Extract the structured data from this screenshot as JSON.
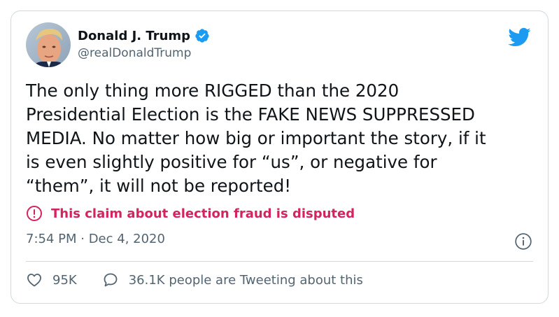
{
  "author": {
    "display_name": "Donald J. Trump",
    "handle": "@realDonaldTrump",
    "verified": true
  },
  "tweet": {
    "text": "The only thing more RIGGED than the 2020\nPresidential Election is the FAKE NEWS SUPPRESSED\nMEDIA. No matter how big or important the story, if it\nis even slightly positive for “us”, or negative for\n“them”, it will not be reported!",
    "timestamp": "7:54 PM · Dec 4, 2020"
  },
  "notice": {
    "text": "This claim about election fraud is disputed",
    "icon": "alert-circle-icon"
  },
  "engagement": {
    "likes": "95K",
    "conversation": "36.1K people are Tweeting about this"
  },
  "colors": {
    "accent": "#1d9bf0",
    "notice": "#d3245d",
    "secondary_text": "#536471",
    "border": "#cfd9de"
  }
}
